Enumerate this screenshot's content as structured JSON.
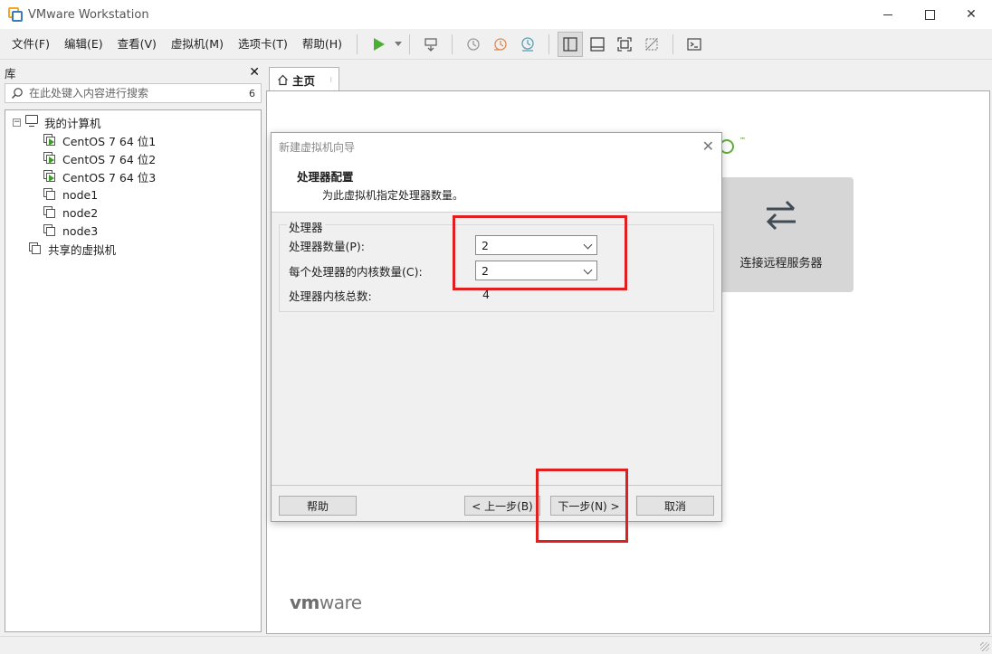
{
  "window": {
    "title": "VMware Workstation",
    "close_glyph": "✕"
  },
  "menu": [
    "文件(F)",
    "编辑(E)",
    "查看(V)",
    "虚拟机(M)",
    "选项卡(T)",
    "帮助(H)"
  ],
  "library": {
    "title": "库",
    "close_glyph": "✕",
    "search_placeholder": "在此处键入内容进行搜索",
    "search_count": "6",
    "tree": {
      "root_label": "我的计算机",
      "root_toggle": "−",
      "vms": [
        {
          "label": "CentOS 7 64 位1",
          "running": true
        },
        {
          "label": "CentOS 7 64 位2",
          "running": true
        },
        {
          "label": "CentOS 7 64 位3",
          "running": true
        },
        {
          "label": "node1",
          "running": false
        },
        {
          "label": "node2",
          "running": false
        },
        {
          "label": "node3",
          "running": false
        }
      ],
      "shared_label": "共享的虚拟机"
    }
  },
  "tabs": {
    "home_label": "主页",
    "home_close": "⁝"
  },
  "home": {
    "remote_label": "连接远程服务器",
    "brand_tm": "™",
    "vmware_logo_bold": "vm",
    "vmware_logo_rest": "ware"
  },
  "dialog": {
    "title": "新建虚拟机向导",
    "close_glyph": "✕",
    "heading": "处理器配置",
    "subheading": "为此虚拟机指定处理器数量。",
    "group_title": "处理器",
    "processor_count_label": "处理器数量(P):",
    "processor_count_value": "2",
    "cores_label": "每个处理器的内核数量(C):",
    "cores_value": "2",
    "total_label": "处理器内核总数:",
    "total_value": "4",
    "buttons": {
      "help": "帮助",
      "back": "< 上一步(B)",
      "next": "下一步(N) >",
      "cancel": "取消"
    }
  },
  "colors": {
    "highlight": "#e02020",
    "run_green": "#3f9a2c",
    "vmware_green": "#5fae3b"
  }
}
